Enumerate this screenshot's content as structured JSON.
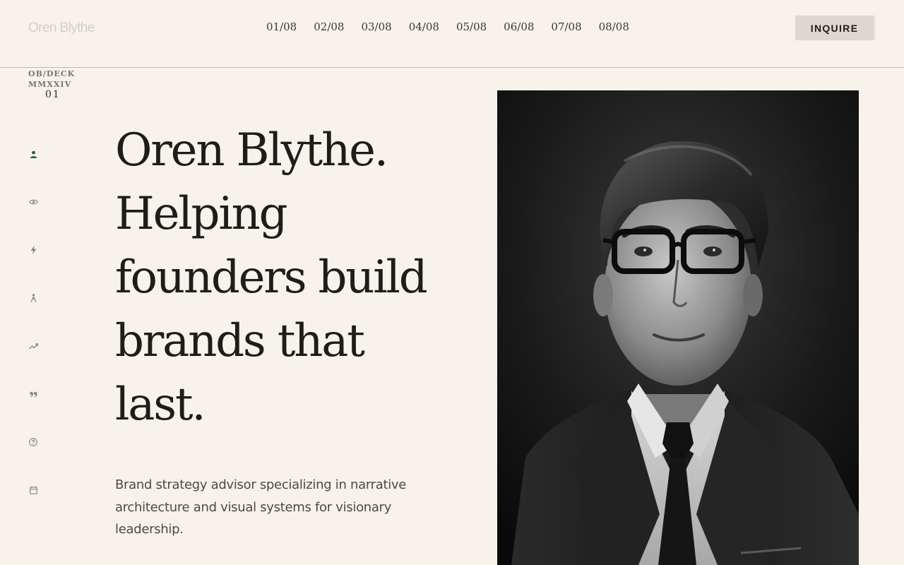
{
  "header": {
    "brand": "Oren Blythe",
    "nav": [
      "01/08",
      "02/08",
      "03/08",
      "04/08",
      "05/08",
      "06/08",
      "07/08",
      "08/08"
    ],
    "inquire_label": "INQUIRE"
  },
  "deck": {
    "line1": "OB/DECK",
    "line2": "MMXXIV",
    "slide": "01"
  },
  "sidebar": {
    "icons": [
      "user-icon",
      "eye-icon",
      "bolt-icon",
      "figure-icon",
      "trend-icon",
      "quote-icon",
      "help-icon",
      "calendar-icon"
    ],
    "active_color": "#2e5a3f",
    "muted_color": "#8c887f"
  },
  "hero": {
    "headline": [
      "Oren Blythe.",
      "Helping",
      "founders build",
      "brands that",
      "last."
    ],
    "description": "Brand strategy advisor specializing in narrative architecture and visual systems for visionary leadership."
  },
  "colors": {
    "background": "#f7f3ea",
    "text": "#1f1d18",
    "button": "#dcd8ce"
  }
}
